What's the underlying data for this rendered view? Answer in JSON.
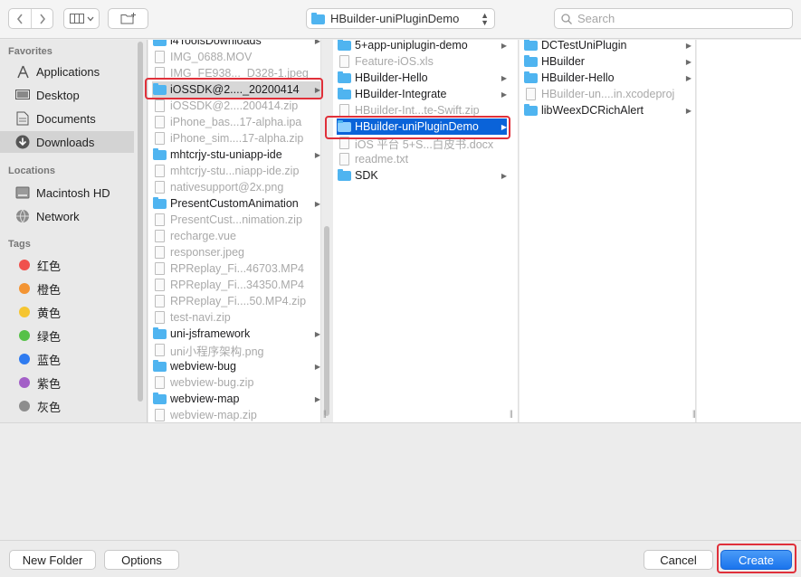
{
  "toolbar": {
    "location": "HBuilder-uniPluginDemo",
    "search_placeholder": "Search"
  },
  "sidebar": {
    "favorites_header": "Favorites",
    "favorites": [
      {
        "label": "Applications",
        "icon": "applications-icon"
      },
      {
        "label": "Desktop",
        "icon": "desktop-icon"
      },
      {
        "label": "Documents",
        "icon": "documents-icon"
      },
      {
        "label": "Downloads",
        "icon": "downloads-icon",
        "selected": true
      }
    ],
    "locations_header": "Locations",
    "locations": [
      {
        "label": "Macintosh HD",
        "icon": "hard-drive-icon"
      },
      {
        "label": "Network",
        "icon": "network-icon"
      }
    ],
    "tags_header": "Tags",
    "tags": [
      {
        "label": "红色",
        "color": "#f0514d"
      },
      {
        "label": "橙色",
        "color": "#f39433"
      },
      {
        "label": "黄色",
        "color": "#f5c531"
      },
      {
        "label": "绿色",
        "color": "#56c148"
      },
      {
        "label": "蓝色",
        "color": "#2f7bf0"
      },
      {
        "label": "紫色",
        "color": "#a35fc7"
      },
      {
        "label": "灰色",
        "color": "#8d8d8d"
      }
    ]
  },
  "columns": {
    "downloads": [
      {
        "label": "i4ToolsDownloads",
        "type": "folder",
        "arrow": true
      },
      {
        "label": "IMG_0688.MOV",
        "type": "file",
        "dim": true
      },
      {
        "label": "IMG_FE938..._D328-1.jpeg",
        "type": "file",
        "dim": true
      },
      {
        "label": "iOSSDK@2...._20200414",
        "type": "folder",
        "arrow": true,
        "highlight": true
      },
      {
        "label": "iOSSDK@2....200414.zip",
        "type": "file",
        "dim": true
      },
      {
        "label": "iPhone_bas...17-alpha.ipa",
        "type": "file",
        "dim": true
      },
      {
        "label": "iPhone_sim....17-alpha.zip",
        "type": "file",
        "dim": true
      },
      {
        "label": "mhtcrjy-stu-uniapp-ide",
        "type": "folder",
        "arrow": true
      },
      {
        "label": "mhtcrjy-stu...niapp-ide.zip",
        "type": "file",
        "dim": true
      },
      {
        "label": "nativesupport@2x.png",
        "type": "file",
        "dim": true
      },
      {
        "label": "PresentCustomAnimation",
        "type": "folder",
        "arrow": true
      },
      {
        "label": "PresentCust...nimation.zip",
        "type": "file",
        "dim": true
      },
      {
        "label": "recharge.vue",
        "type": "file",
        "dim": true
      },
      {
        "label": "responser.jpeg",
        "type": "file",
        "dim": true
      },
      {
        "label": "RPReplay_Fi...46703.MP4",
        "type": "file",
        "dim": true
      },
      {
        "label": "RPReplay_Fi...34350.MP4",
        "type": "file",
        "dim": true
      },
      {
        "label": "RPReplay_Fi....50.MP4.zip",
        "type": "file",
        "dim": true
      },
      {
        "label": "test-navi.zip",
        "type": "file",
        "dim": true
      },
      {
        "label": "uni-jsframework",
        "type": "folder",
        "arrow": true
      },
      {
        "label": "uni小程序架构.png",
        "type": "file",
        "dim": true
      },
      {
        "label": "webview-bug",
        "type": "folder",
        "arrow": true
      },
      {
        "label": "webview-bug.zip",
        "type": "file",
        "dim": true
      },
      {
        "label": "webview-map",
        "type": "folder",
        "arrow": true
      },
      {
        "label": "webview-map.zip",
        "type": "file",
        "dim": true
      }
    ],
    "sdk": [
      {
        "label": "5+app-uniplugin-demo",
        "type": "folder",
        "arrow": true
      },
      {
        "label": "Feature-iOS.xls",
        "type": "file",
        "dim": true
      },
      {
        "label": "HBuilder-Hello",
        "type": "folder",
        "arrow": true
      },
      {
        "label": "HBuilder-Integrate",
        "type": "folder",
        "arrow": true
      },
      {
        "label": "HBuilder-Int...te-Swift.zip",
        "type": "file",
        "dim": true
      },
      {
        "label": "HBuilder-uniPluginDemo",
        "type": "folder",
        "arrow": true,
        "selected": true
      },
      {
        "label": "iOS 平台 5+S...白皮书.docx",
        "type": "file",
        "dim": true
      },
      {
        "label": "readme.txt",
        "type": "file",
        "dim": true
      },
      {
        "label": "SDK",
        "type": "folder",
        "arrow": true
      }
    ],
    "demo": [
      {
        "label": "DCTestUniPlugin",
        "type": "folder",
        "arrow": true
      },
      {
        "label": "HBuilder",
        "type": "folder",
        "arrow": true
      },
      {
        "label": "HBuilder-Hello",
        "type": "folder",
        "arrow": true
      },
      {
        "label": "HBuilder-un....in.xcodeproj",
        "type": "file",
        "dim": true
      },
      {
        "label": "libWeexDCRichAlert",
        "type": "folder",
        "arrow": true
      }
    ]
  },
  "footer": {
    "new_folder": "New Folder",
    "options": "Options",
    "cancel": "Cancel",
    "create": "Create"
  }
}
